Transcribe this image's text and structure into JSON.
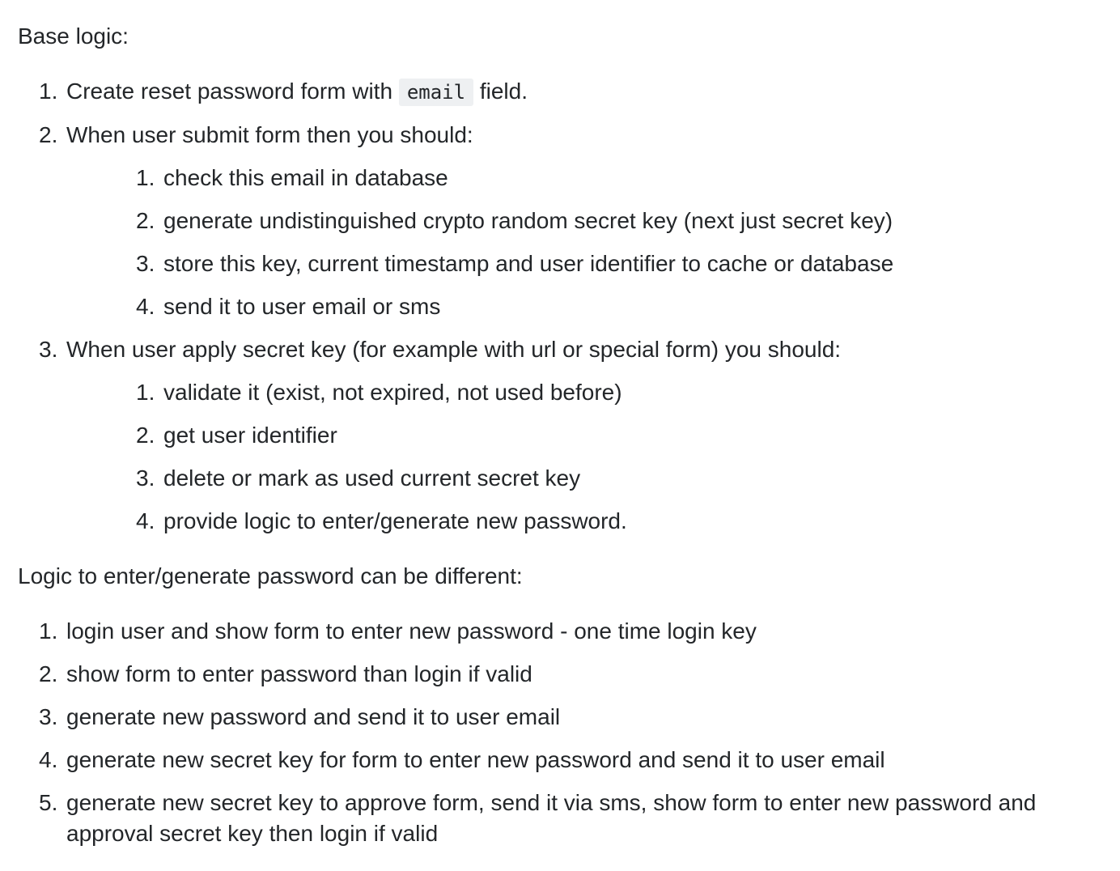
{
  "section1": {
    "intro": "Base logic:",
    "items": [
      {
        "number": "1.",
        "text_before": "Create reset password form with",
        "code": "email",
        "text_after": "field."
      },
      {
        "number": "2.",
        "text": "When user submit form then you should:",
        "subitems": [
          {
            "number": "1.",
            "text": "check this email in database"
          },
          {
            "number": "2.",
            "text": "generate undistinguished crypto random secret key (next just secret key)"
          },
          {
            "number": "3.",
            "text": "store this key, current timestamp and user identifier to cache or database"
          },
          {
            "number": "4.",
            "text": "send it to user email or sms"
          }
        ]
      },
      {
        "number": "3.",
        "text": "When user apply secret key (for example with url or special form) you should:",
        "subitems": [
          {
            "number": "1.",
            "text": "validate it (exist, not expired, not used before)"
          },
          {
            "number": "2.",
            "text": "get user identifier"
          },
          {
            "number": "3.",
            "text": "delete or mark as used current secret key"
          },
          {
            "number": "4.",
            "text": "provide logic to enter/generate new password."
          }
        ]
      }
    ]
  },
  "section2": {
    "intro": "Logic to enter/generate password can be different:",
    "items": [
      {
        "number": "1.",
        "text": "login user and show form to enter new password - one time login key"
      },
      {
        "number": "2.",
        "text": "show form to enter password than login if valid"
      },
      {
        "number": "3.",
        "text": "generate new password and send it to user email"
      },
      {
        "number": "4.",
        "text": "generate new secret key for form to enter new password and send it to user email"
      },
      {
        "number": "5.",
        "text": "generate new secret key to approve form, send it via sms, show form to enter new password and approval secret key then login if valid"
      }
    ]
  }
}
